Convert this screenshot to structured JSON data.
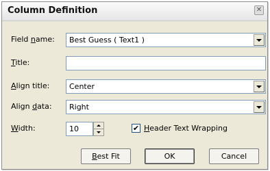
{
  "dialog": {
    "title": "Column Definition",
    "close_glyph": "✕"
  },
  "fields": {
    "field_name": {
      "label_pre": "Field ",
      "label_ul": "n",
      "label_post": "ame:",
      "value": "Best Guess ( Text1 )"
    },
    "title": {
      "label_pre": "",
      "label_ul": "T",
      "label_post": "itle:",
      "value": ""
    },
    "align_title": {
      "label_pre": "",
      "label_ul": "A",
      "label_post": "lign title:",
      "value": "Center"
    },
    "align_data": {
      "label_pre": "Align ",
      "label_ul": "d",
      "label_post": "ata:",
      "value": "Right"
    },
    "width": {
      "label_pre": "",
      "label_ul": "W",
      "label_post": "idth:",
      "value": "10"
    }
  },
  "header_wrap": {
    "checked": true,
    "check_glyph": "✔",
    "label_pre": "",
    "label_ul": "H",
    "label_post": "eader Text Wrapping"
  },
  "buttons": {
    "best_fit": {
      "pre": "",
      "ul": "B",
      "post": "est Fit"
    },
    "ok": "OK",
    "cancel": "Cancel"
  },
  "colors": {
    "dialog_bg": "#ece9d8",
    "field_border": "#7f9db9"
  }
}
